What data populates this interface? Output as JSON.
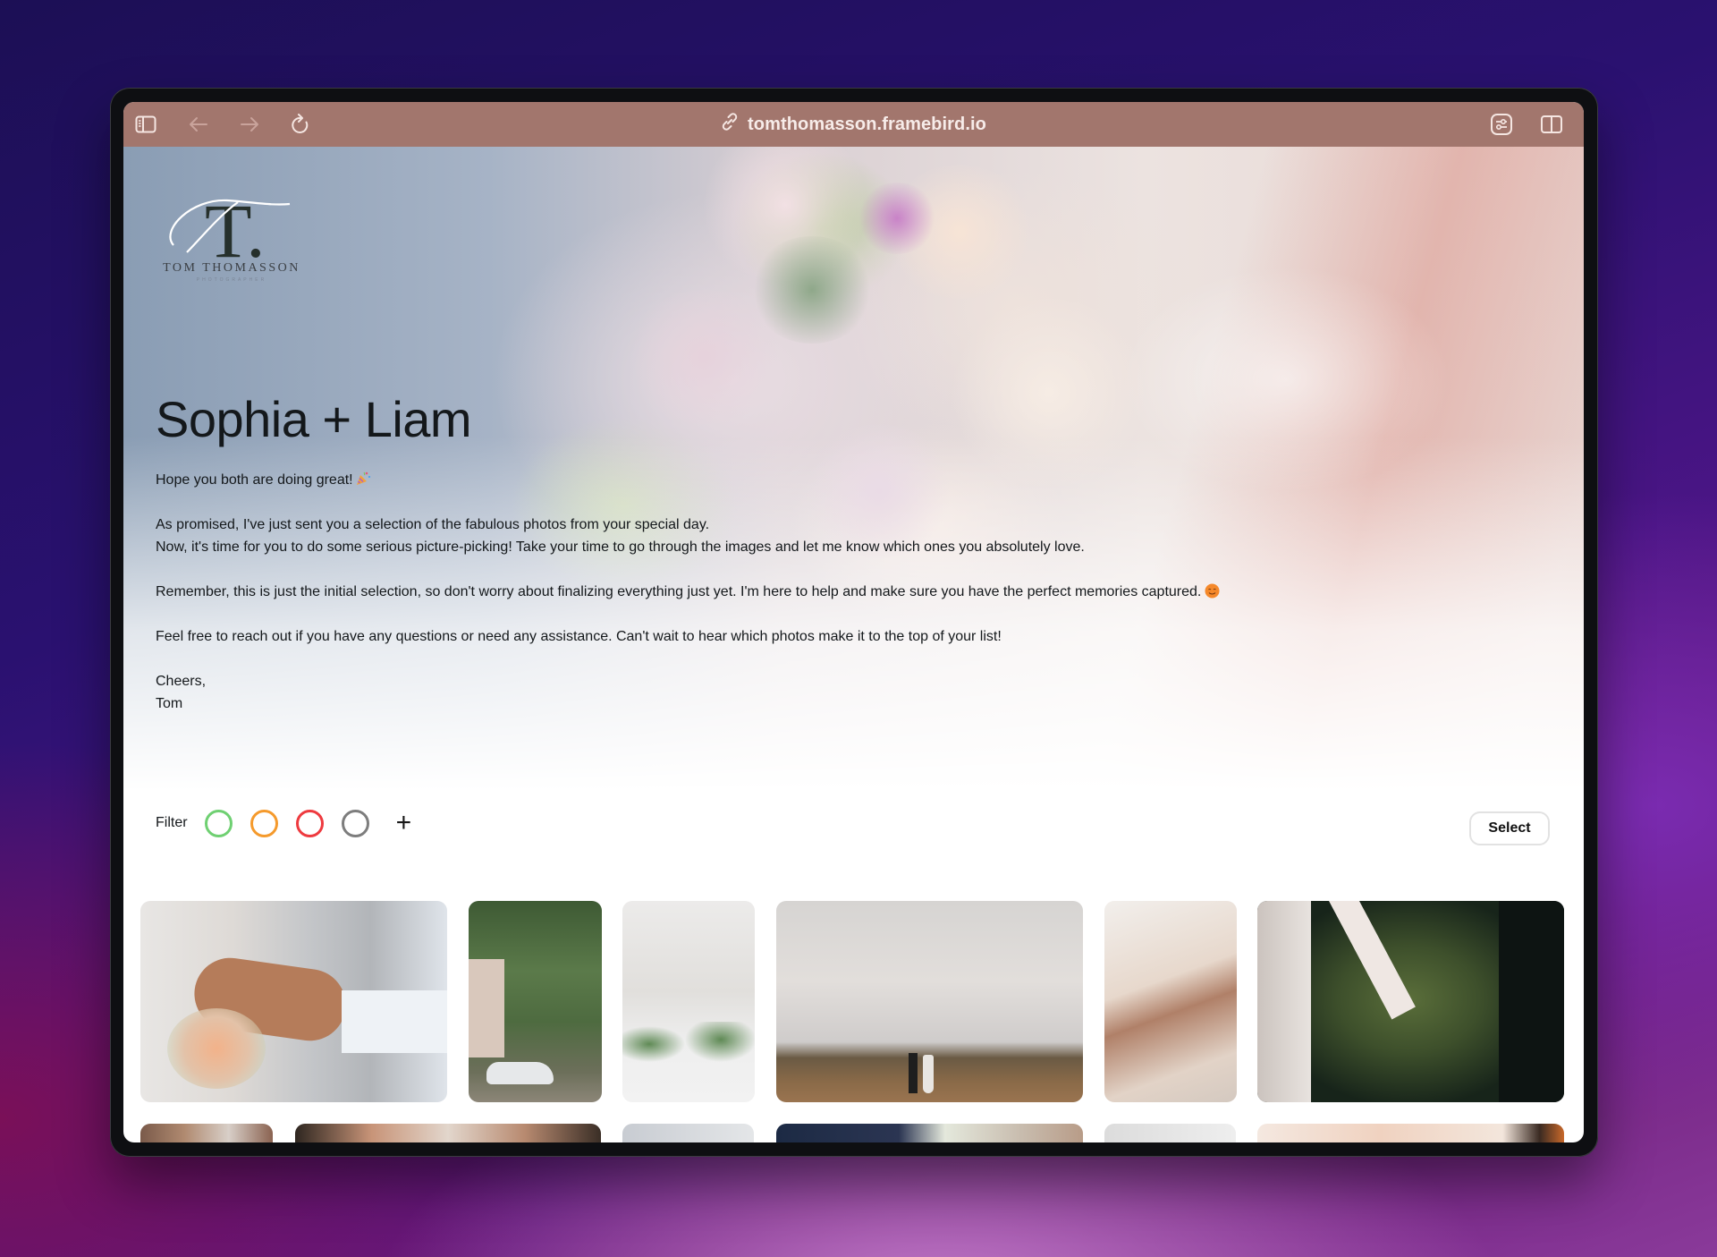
{
  "browser": {
    "url": "tomthomasson.framebird.io",
    "toolbar_icons": [
      "sidebar-icon",
      "back-arrow-icon",
      "forward-arrow-icon",
      "reload-icon",
      "link-icon",
      "settings-sliders-icon",
      "split-view-icon"
    ],
    "toolbar_color": "#a2766d"
  },
  "logo": {
    "monogram": "T.",
    "name": "TOM THOMASSON",
    "subtitle": "PHOTOGRAPHER"
  },
  "gallery": {
    "title": "Sophia + Liam",
    "message": {
      "greeting": "Hope you both are doing great!",
      "greeting_emoji": "party-popper",
      "para1_line1": "As promised, I've just sent you a selection of the fabulous photos from your special day.",
      "para1_line2": "Now, it's time for you to do some serious picture-picking! Take your time to go through the images and let me know which ones you absolutely love.",
      "para2": "Remember, this is just the initial selection, so don't worry about finalizing everything just yet. I'm here to help and make sure you have the perfect memories captured.",
      "para2_emoji": "smiling-face",
      "para3": "Feel free to reach out if you have any questions or need any assistance. Can't wait to hear which photos make it to the top of your list!",
      "signoff": "Cheers,",
      "signature": "Tom"
    }
  },
  "filter": {
    "label": "Filter",
    "colors": [
      {
        "name": "green",
        "hex": "#6fd072"
      },
      {
        "name": "orange",
        "hex": "#f59a2c"
      },
      {
        "name": "red",
        "hex": "#ee3a3f"
      },
      {
        "name": "gray",
        "hex": "#7d7d7d"
      }
    ],
    "add_label": "+",
    "select_label": "Select"
  },
  "photos": [
    {
      "subject": "hands with rings and bouquet",
      "row": 1
    },
    {
      "subject": "vintage car under trees",
      "row": 1
    },
    {
      "subject": "reception table under chandelier",
      "row": 1
    },
    {
      "subject": "couple walking on hillside",
      "row": 1
    },
    {
      "subject": "couple kissing under veil",
      "row": 1
    },
    {
      "subject": "holding hands on grass",
      "row": 1
    },
    {
      "subject": "ornate ceiling",
      "row": 2
    },
    {
      "subject": "bridesmaids group",
      "row": 2
    },
    {
      "subject": "bright window",
      "row": 2
    },
    {
      "subject": "night bouquet",
      "row": 2
    },
    {
      "subject": "light interior",
      "row": 2
    },
    {
      "subject": "warm blurred detail",
      "row": 2
    }
  ]
}
